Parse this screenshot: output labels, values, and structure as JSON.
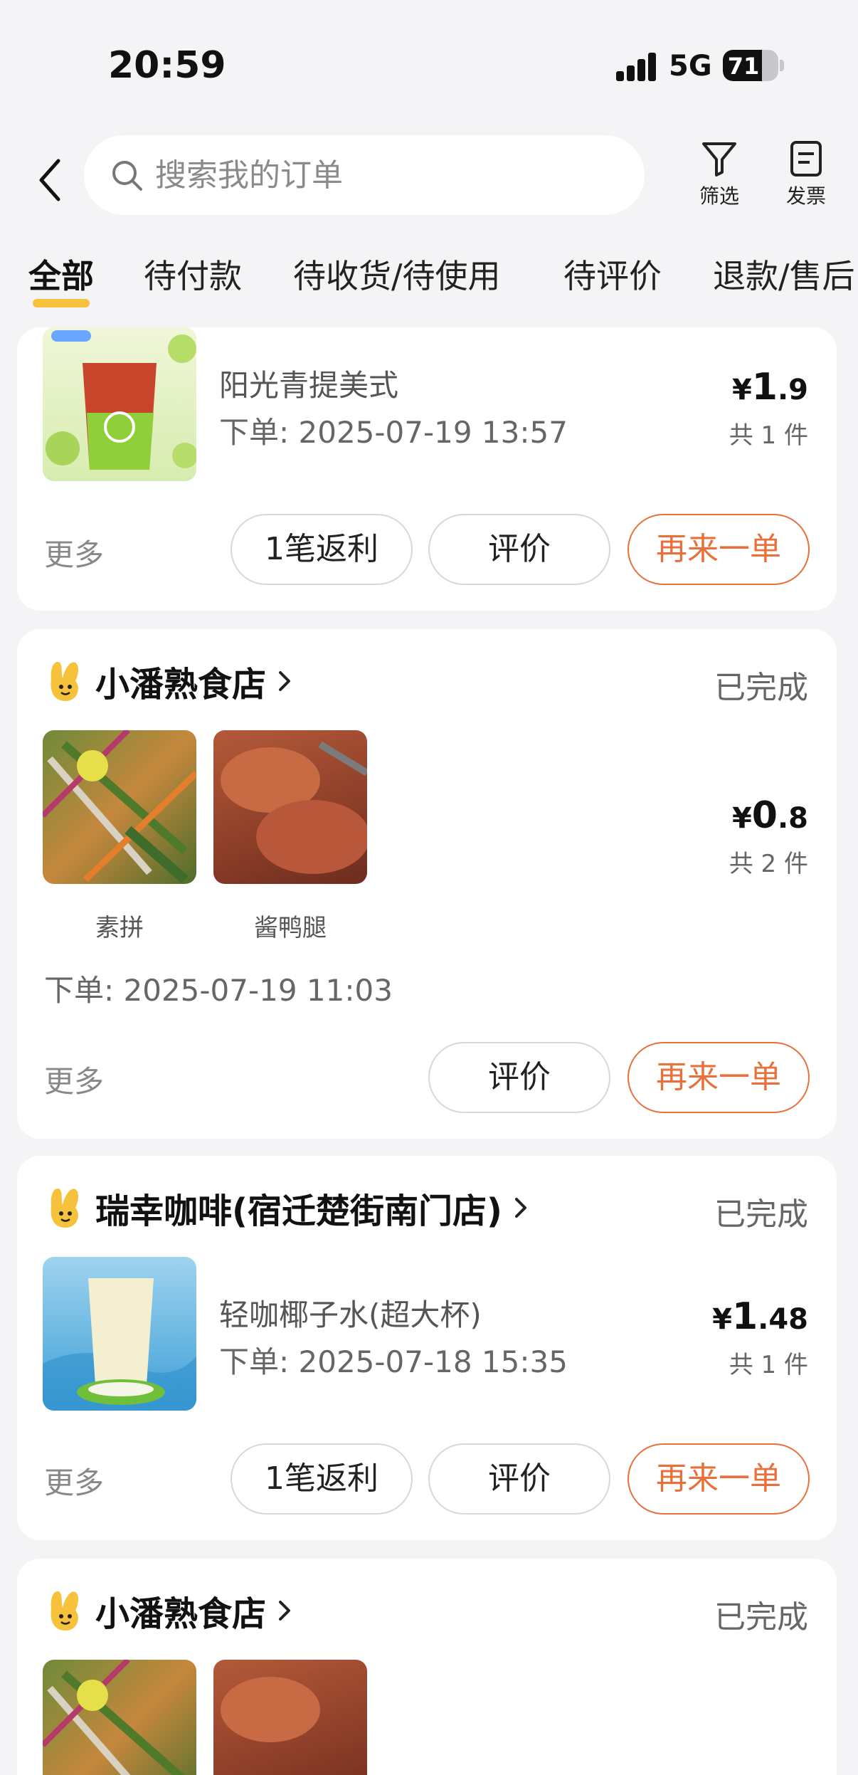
{
  "status_bar": {
    "time": "20:59",
    "network": "5G",
    "battery": "71",
    "battery_level": 0.71
  },
  "header": {
    "search_placeholder": "搜索我的订单",
    "filter_label": "筛选",
    "invoice_label": "发票"
  },
  "tabs": [
    "全部",
    "待付款",
    "待收货/待使用",
    "待评价",
    "退款/售后"
  ],
  "orders": [
    {
      "item_name": "阳光青提美式",
      "order_time": "下单: 2025-07-19 13:57",
      "price_symbol": "¥",
      "price_int": "1",
      "price_dec": ".9",
      "count": "共 1 件",
      "more": "更多",
      "rebate_button": "1笔返利",
      "review_button": "评价",
      "reorder_button": "再来一单"
    },
    {
      "store_name": "小潘熟食店",
      "status": "已完成",
      "items": [
        {
          "name": "素拼"
        },
        {
          "name": "酱鸭腿"
        }
      ],
      "price_symbol": "¥",
      "price_int": "0",
      "price_dec": ".8",
      "count": "共 2 件",
      "order_time": "下单: 2025-07-19 11:03",
      "more": "更多",
      "review_button": "评价",
      "reorder_button": "再来一单"
    },
    {
      "store_name": "瑞幸咖啡(宿迁楚街南门店)",
      "status": "已完成",
      "item_name": "轻咖椰子水(超大杯)",
      "order_time": "下单: 2025-07-18 15:35",
      "price_symbol": "¥",
      "price_int": "1",
      "price_dec": ".48",
      "count": "共 1 件",
      "more": "更多",
      "rebate_button": "1笔返利",
      "review_button": "评价",
      "reorder_button": "再来一单"
    },
    {
      "store_name": "小潘熟食店",
      "status": "已完成"
    }
  ],
  "colors": {
    "accent": "#e8703a",
    "tab_indicator": "#f7c23b",
    "background": "#f4f4f6"
  }
}
